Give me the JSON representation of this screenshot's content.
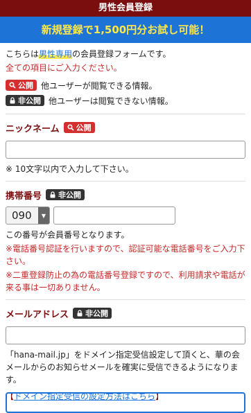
{
  "header": {
    "title": "男性会員登録",
    "promo": "新規登録で1,500円分お試し可能！"
  },
  "intro": {
    "line1_prefix": "こちらは",
    "line1_highlight": "男性専用",
    "line1_suffix": "の会員登録フォームです。",
    "line2": "全ての項目にご入力ください。"
  },
  "badges": {
    "public": "公開",
    "private": "非公開"
  },
  "legend": {
    "public_text": "他ユーザーが閲覧できる情報。",
    "private_text": "他ユーザーは閲覧できない情報。"
  },
  "nickname": {
    "label": "ニックネーム",
    "value": "",
    "note": "※ 10文字以内で入力して下さい。"
  },
  "phone": {
    "label": "携帯番号",
    "prefix_selected": "090",
    "number_value": "",
    "info": "この番号が会員番号となります。",
    "note1": "※電話番号認証を行いますので、認証可能な電話番号をご入力下さい。",
    "note2": "※二重登録防止の為の電話番号登録ですので、利用請求や電話が来る事は一切ありません。"
  },
  "email": {
    "label": "メールアドレス",
    "value": "",
    "info": "「hana-mail.jp」をドメイン指定受信設定して頂くと、華の会メールからのお知らせメールを確実に受信できるようになります。",
    "link_open": "【",
    "link_text": "ドメイン指定受信の設定方法はこちら",
    "link_close": "】"
  },
  "colors": {
    "header_bg": "#7a0e0e",
    "promo_bg": "#1e74d6",
    "promo_text": "#ffe74a",
    "public_badge": "#d32f2f",
    "private_badge": "#333333",
    "warning_text": "#c62828"
  },
  "icons": {
    "public": "search-icon",
    "private": "lock-icon",
    "select_arrow": "triangle-down-icon"
  }
}
